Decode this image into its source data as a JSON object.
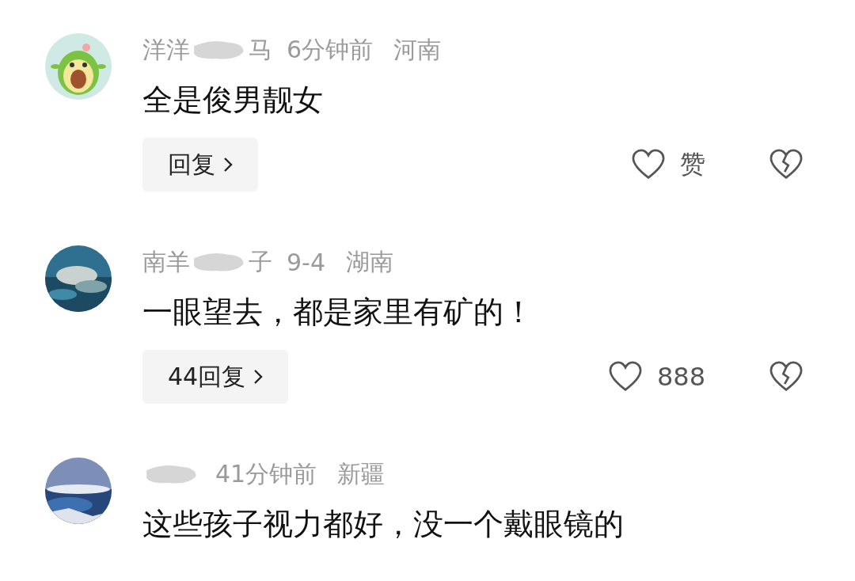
{
  "comments": [
    {
      "avatar": {
        "kind": "avocado"
      },
      "name_start": "洋洋",
      "name_end": "马",
      "time": "6分钟前",
      "region": "河南",
      "text": "全是俊男靓女",
      "reply_label": "回复",
      "like_label": "赞"
    },
    {
      "name_start": "南羊",
      "name_end": "子",
      "time": "9-4",
      "region": "湖南",
      "text": "一眼望去，都是家里有矿的！",
      "reply_label": "44回复",
      "like_label": "888"
    },
    {
      "time": "41分钟前",
      "region": "新疆",
      "text": "这些孩子视力都好，没一个戴眼镜的"
    }
  ]
}
